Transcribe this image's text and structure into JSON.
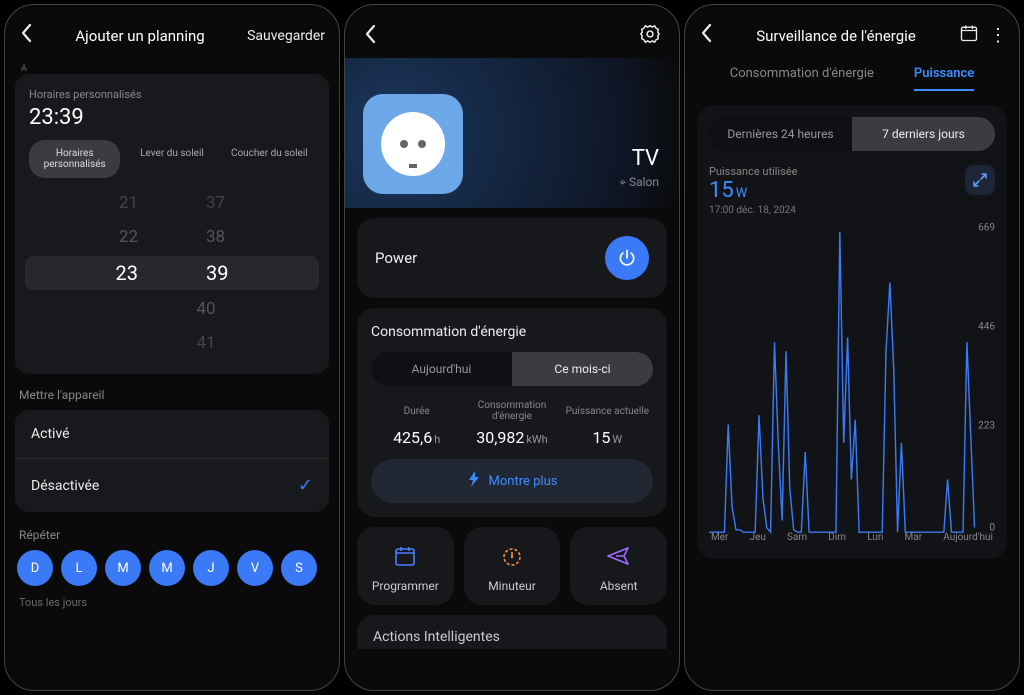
{
  "phone1": {
    "title": "Ajouter un planning",
    "save": "Sauvegarder",
    "section_a": "A",
    "custom_hours_label": "Horaires personnalisés",
    "time": "23:39",
    "time_modes": [
      "Horaires personnalisés",
      "Lever du soleil",
      "Coucher du soleil"
    ],
    "wheel": {
      "hours": [
        "21",
        "22",
        "23",
        " ",
        " "
      ],
      "minutes": [
        "37",
        "38",
        "39",
        "40",
        "41"
      ]
    },
    "device_label": "Mettre l'appareil",
    "state_on": "Activé",
    "state_off": "Désactivée",
    "repeat_label": "Répéter",
    "days": [
      "D",
      "L",
      "M",
      "M",
      "J",
      "V",
      "S"
    ],
    "every_day": "Tous les jours"
  },
  "phone2": {
    "device_name": "TV",
    "room": "Salon",
    "power_label": "Power",
    "cons_title": "Consommation d'énergie",
    "periods": [
      "Aujourd'hui",
      "Ce mois-ci"
    ],
    "stats": {
      "duration_label": "Durée",
      "duration_val": "425,6",
      "duration_unit": "h",
      "energy_label": "Consommation d'énergie",
      "energy_val": "30,982",
      "energy_unit": "kWh",
      "power_label": "Puissance actuelle",
      "power_val": "15",
      "power_unit": "W"
    },
    "show_more": "Montre plus",
    "actions": {
      "schedule": "Programmer",
      "timer": "Minuteur",
      "away": "Absent"
    },
    "ai": "Actions Intelligentes"
  },
  "phone3": {
    "title": "Surveillance de l'énergie",
    "tabs": [
      "Consommation d'énergie",
      "Puissance"
    ],
    "ranges": [
      "Dernières 24 heures",
      "7 derniers jours"
    ],
    "pu_label": "Puissance utilisée",
    "pu_val": "15",
    "pu_unit": "W",
    "timestamp": "17:00  déc. 18, 2024",
    "ymax": 669,
    "yticks": [
      "669",
      "446",
      "223",
      "0"
    ],
    "xlabels": [
      "Mer",
      "Jeu",
      "Sam",
      "Dim",
      "Lun",
      "Mar",
      "Aujourd'hui"
    ]
  },
  "chart_data": {
    "type": "line",
    "title": "Puissance utilisée",
    "ylabel": "W",
    "ylim": [
      0,
      669
    ],
    "x": [
      0,
      1,
      2,
      3,
      4,
      5,
      6,
      7,
      8,
      9,
      10,
      11,
      12,
      13,
      14,
      15,
      16,
      17,
      18,
      19,
      20,
      21,
      22,
      23,
      24,
      25,
      26,
      27,
      28,
      29,
      30,
      31,
      32,
      33,
      34,
      35,
      36,
      37,
      38,
      39,
      40,
      41,
      42,
      43,
      44,
      45,
      46,
      47,
      48,
      49,
      50,
      51,
      52,
      53,
      54,
      55,
      56,
      57,
      58,
      59,
      60,
      61,
      62,
      63,
      64,
      65,
      66,
      67,
      68,
      69
    ],
    "values": [
      5,
      5,
      5,
      5,
      5,
      240,
      60,
      10,
      10,
      5,
      5,
      5,
      5,
      260,
      80,
      15,
      5,
      420,
      200,
      30,
      400,
      100,
      10,
      5,
      5,
      180,
      5,
      5,
      5,
      5,
      5,
      5,
      5,
      5,
      660,
      200,
      430,
      120,
      250,
      5,
      5,
      5,
      5,
      5,
      5,
      5,
      400,
      550,
      360,
      5,
      200,
      5,
      5,
      5,
      5,
      5,
      5,
      5,
      5,
      5,
      5,
      5,
      120,
      5,
      5,
      5,
      5,
      420,
      220,
      15
    ],
    "xlabels": [
      "Mer",
      "Jeu",
      "Sam",
      "Dim",
      "Lun",
      "Mar",
      "Aujourd'hui"
    ]
  }
}
